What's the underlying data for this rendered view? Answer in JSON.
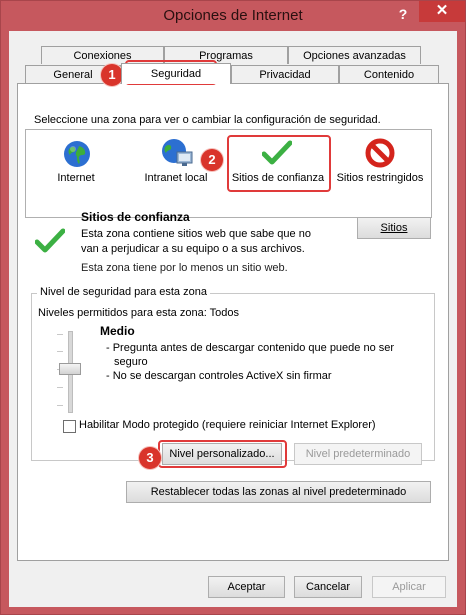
{
  "window": {
    "title": "Opciones de Internet",
    "help_glyph": "?",
    "close_glyph": "✕"
  },
  "tabs": {
    "row1": [
      "Conexiones",
      "Programas",
      "Opciones avanzadas"
    ],
    "row2": [
      "General",
      "Seguridad",
      "Privacidad",
      "Contenido"
    ],
    "active": "Seguridad"
  },
  "security": {
    "instruction": "Seleccione una zona para ver o cambiar la configuración de seguridad.",
    "zones": [
      {
        "label": "Internet",
        "icon": "globe-icon"
      },
      {
        "label": "Intranet local",
        "icon": "intranet-icon"
      },
      {
        "label": "Sitios de confianza",
        "icon": "checkmark-icon"
      },
      {
        "label": "Sitios restringidos",
        "icon": "restricted-icon"
      }
    ],
    "selected_zone": "Sitios de confianza",
    "zone_title": "Sitios de confianza",
    "zone_description_1": "Esta zona contiene sitios web que sabe que no",
    "zone_description_2": "van a perjudicar a su equipo o a sus archivos.",
    "zone_note": "Esta zona tiene por lo menos un sitio web.",
    "sites_button": "Sitios",
    "level_group_title": "Nivel de seguridad para esta zona",
    "allowed_levels": "Niveles permitidos para esta zona: Todos",
    "level_name": "Medio",
    "level_bullet_1a": "- Pregunta antes de descargar contenido que puede no ser",
    "level_bullet_1b": "seguro",
    "level_bullet_2": "- No se descargan controles ActiveX sin firmar",
    "protected_mode_label": "Habilitar Modo protegido (requiere reiniciar Internet Explorer)",
    "protected_mode_checked": false,
    "custom_level_button": "Nivel personalizado...",
    "default_level_button": "Nivel predeterminado",
    "reset_all_button": "Restablecer todas las zonas al nivel predeterminado"
  },
  "footer": {
    "accept": "Aceptar",
    "cancel": "Cancelar",
    "apply": "Aplicar"
  },
  "callouts": [
    "1",
    "2",
    "3"
  ],
  "colors": {
    "window_frame": "#c6585e",
    "close_button": "#c73a3a",
    "callout": "#d9342b",
    "highlight": "#e03a3a"
  }
}
